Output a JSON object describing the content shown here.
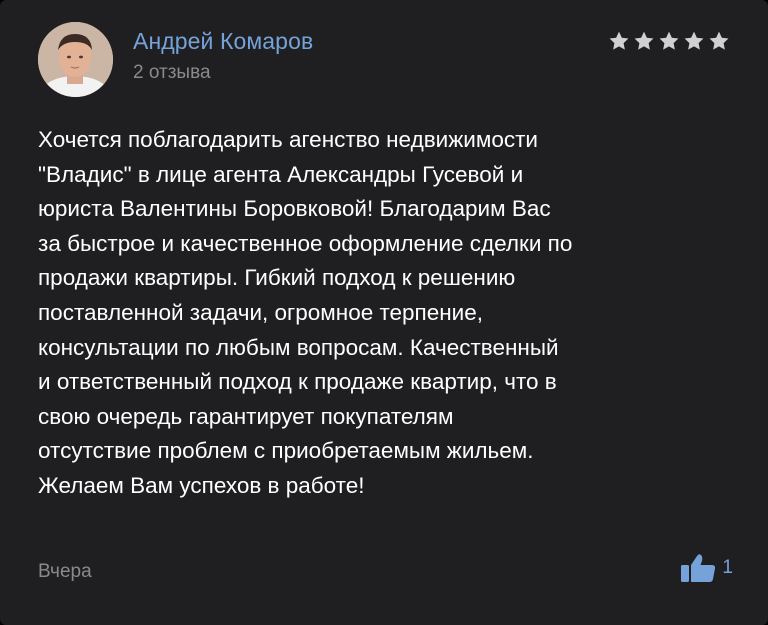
{
  "review": {
    "author_name": "Андрей Комаров",
    "review_count": "2 отзыва",
    "rating": 5,
    "text": "Хочется поблагодарить агенство недвижимости\n\"Владис\" в лице агента Александры Гусевой и\nюриста Валентины Боровковой! Благодарим Вас\nза быстрое и качественное оформление сделки по\nпродажи квартиры. Гибкий подход к решению\nпоставленной задачи, огромное терпение,\nконсультации по любым вопросам. Качественный\nи ответственный подход к продаже квартир, что в\nсвою очередь гарантирует покупателям\nотсутствие проблем с приобретаемым жильем.\nЖелаем Вам успехов в работе!",
    "date": "Вчера",
    "likes": "1"
  },
  "colors": {
    "background": "#000000",
    "card": "#1f1f21",
    "accent": "#75a2d8",
    "secondary_text": "#8a8a8e",
    "star": "#d0d0d0"
  },
  "icons": {
    "avatar": "user-photo",
    "star": "star-icon",
    "like": "thumbs-up-icon"
  }
}
